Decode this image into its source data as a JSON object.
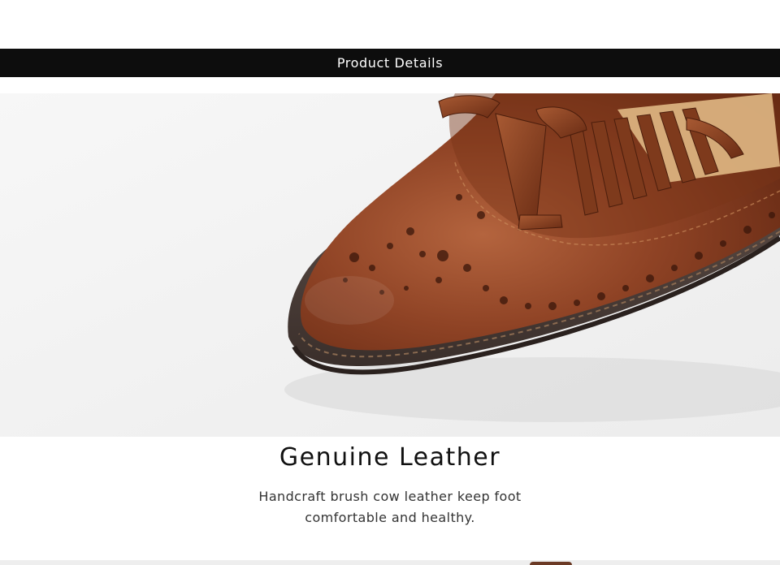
{
  "banner": {
    "title": "Product Details"
  },
  "feature": {
    "heading": "Genuine Leather",
    "description_lines": [
      "Handcraft brush cow leather keep foot",
      "comfortable and healthy."
    ]
  },
  "photo": {
    "subject": "brown tasseled leather brogue loafer toe close-up"
  },
  "colors": {
    "banner_bg": "#0d0d0d",
    "leather": "#8a3f22",
    "sole": "#4a3d38"
  }
}
